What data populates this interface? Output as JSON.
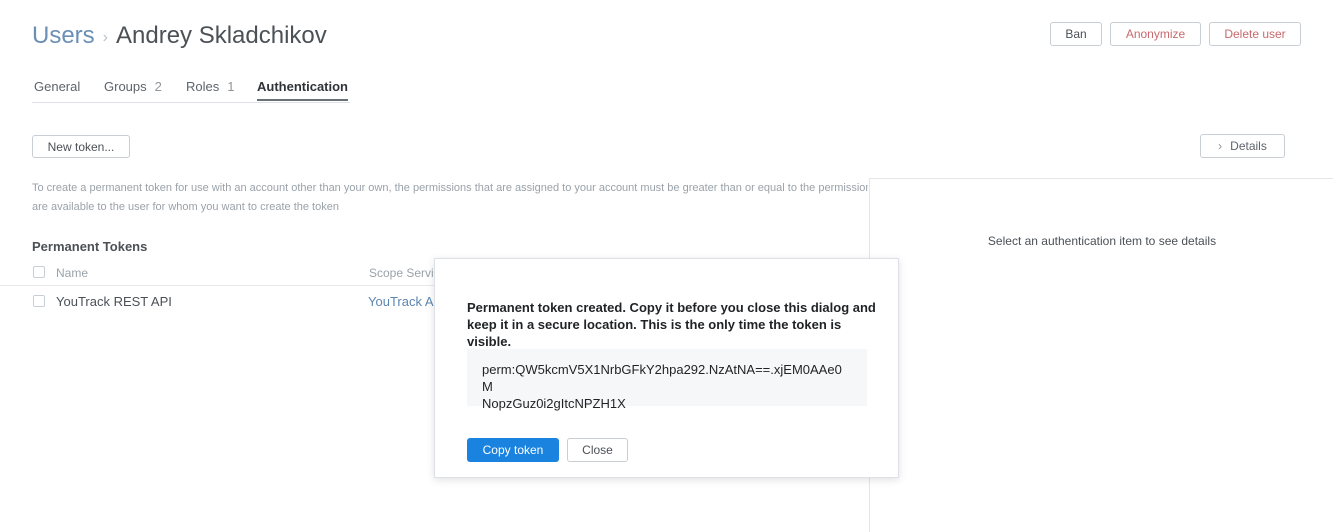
{
  "header": {
    "breadcrumb_link": "Users",
    "breadcrumb_separator": "›",
    "title": "Andrey Skladchikov",
    "ban_label": "Ban",
    "anonymize_label": "Anonymize",
    "delete_label": "Delete user"
  },
  "tabs": [
    {
      "label": "General",
      "count": ""
    },
    {
      "label": "Groups",
      "count": "2"
    },
    {
      "label": "Roles",
      "count": "1"
    },
    {
      "label": "Authentication",
      "count": "",
      "active": true
    }
  ],
  "toolbar": {
    "new_token_label": "New token...",
    "details_label": "Details",
    "details_icon": "chevron-right-icon"
  },
  "hint": {
    "line1": "To create a permanent token for use with an account other than your own, the permissions that are assigned to your account must be greater than or equal to the permissions that",
    "line2": "are available to the user for whom you want to create the token"
  },
  "tokens": {
    "title": "Permanent Tokens",
    "columns": [
      "Name",
      "Scope Services"
    ],
    "rows": [
      {
        "name": "YouTrack REST API",
        "scope": "YouTrack Administration"
      }
    ]
  },
  "details_panel": {
    "empty_text": "Select an authentication item to see details"
  },
  "dialog": {
    "message": "Permanent token created. Copy it before you close this dialog and keep it in a secure location. This is the only time the token is visible.",
    "token_line1": "perm:QW5kcmV5X1NrbGFkY2hpa292.NzAtNA==.xjEM0AAe0M",
    "token_line2": "NopzGuz0i2gItcNPZH1X",
    "copy_label": "Copy token",
    "close_label": "Close"
  },
  "colors": {
    "primary": "#1a83e0",
    "link": "#6b8fb5",
    "danger": "#c9696d"
  }
}
